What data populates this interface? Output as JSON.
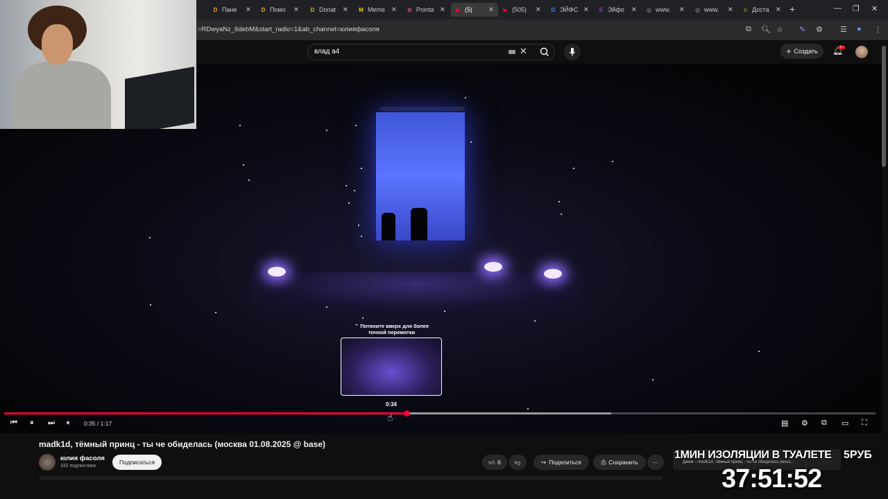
{
  "browser": {
    "tabs": [
      {
        "label": "Пане",
        "icon": "D",
        "color": "#f5a623",
        "active": false
      },
      {
        "label": "Помо",
        "icon": "D",
        "color": "#f5a623",
        "active": false
      },
      {
        "label": "Donat",
        "icon": "D",
        "color": "#f5a623",
        "active": false
      },
      {
        "label": "Meme",
        "icon": "M",
        "color": "#f0c419",
        "active": false
      },
      {
        "label": "Pointa",
        "icon": "✿",
        "color": "#e44d7a",
        "active": false
      },
      {
        "label": "(5(",
        "icon": "▶",
        "color": "#ff0033",
        "active": true
      },
      {
        "label": "(505)",
        "icon": "▶",
        "color": "#ff0033",
        "active": false
      },
      {
        "label": "ЭЙФС",
        "icon": "G",
        "color": "#4285f4",
        "active": false
      },
      {
        "label": "Эйфо",
        "icon": "E",
        "color": "#9b30d9",
        "active": false
      },
      {
        "label": "www.",
        "icon": "◎",
        "color": "#9aa0a6",
        "active": false
      },
      {
        "label": "www.",
        "icon": "◎",
        "color": "#9aa0a6",
        "active": false
      },
      {
        "label": "Доста",
        "icon": "☺",
        "color": "#f7d12d",
        "active": false
      }
    ],
    "new_tab": "+",
    "url": "=RDwyaNz_6debM&start_radio=1&ab_channel=юлияфасоля"
  },
  "youtube": {
    "search_value": "влад а4",
    "create_label": "Создать",
    "notif_count": "9+"
  },
  "player": {
    "tooltip": "⌃ Потяните вверх для более точной перемотки",
    "preview_time": "0:34",
    "time_display": "0:35 / 1:17",
    "progress_played": 0.4614,
    "progress_buffered": 0.697
  },
  "video": {
    "title": "madk1d, тёмный принц - ты че обиделась (москва 01.08.2025 @ base)",
    "channel": "юлия фасоля",
    "subs": "332 подписчика",
    "subscribe_label": "Подписаться",
    "likes": "6",
    "share_label": "Поделиться",
    "save_label": "Сохранить"
  },
  "overlay": {
    "headline": "1МИН ИЗОЛЯЦИИ В ТУАЛЕТЕ",
    "price": "5РУБ",
    "sub": "Джем – madk1d, тёмный принц - ты че обиделась (моск...",
    "timer": "37:51:52"
  }
}
